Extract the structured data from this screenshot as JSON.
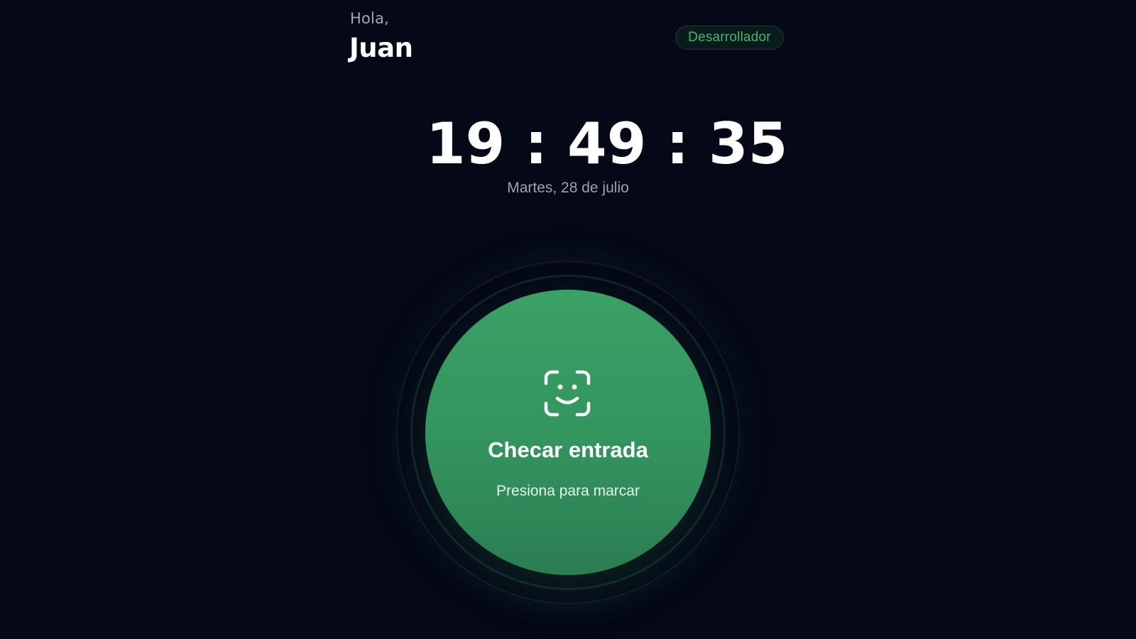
{
  "header": {
    "greeting": "Hola,",
    "username": "Juan",
    "role_badge": "Desarrollador"
  },
  "clock": {
    "time": "19 : 49 : 35",
    "date": "Martes, 28 de julio"
  },
  "check_button": {
    "icon": "face-id-icon",
    "title": "Checar entrada",
    "subtitle": "Presiona para marcar"
  },
  "colors": {
    "background": "#050816",
    "accent": "#3aa166",
    "badge_text": "#46b372"
  }
}
